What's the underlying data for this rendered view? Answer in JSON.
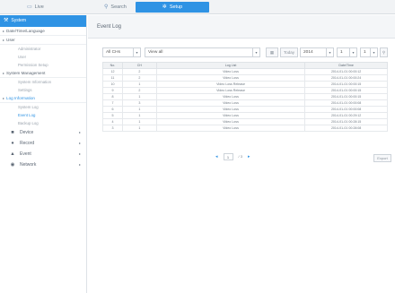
{
  "topbar": {
    "tabs": [
      {
        "label": "Live",
        "icon": "monitor-icon"
      },
      {
        "label": "Search",
        "icon": "search-icon"
      },
      {
        "label": "Setup",
        "icon": "gear-icon"
      }
    ]
  },
  "sidebar": {
    "header": "System",
    "sections": [
      {
        "label": "Date/Time/Language"
      },
      {
        "label": "User",
        "children": [
          "Administrator",
          "User",
          "Permission Setup"
        ]
      },
      {
        "label": "System Management",
        "children": [
          "System Information",
          "Settings"
        ]
      },
      {
        "label": "Log Information",
        "children": [
          "System Log",
          "Event Log",
          "Backup Log"
        ]
      }
    ],
    "main_items": [
      {
        "label": "Device",
        "icon": "camera-icon"
      },
      {
        "label": "Record",
        "icon": "record-icon"
      },
      {
        "label": "Event",
        "icon": "event-icon"
      },
      {
        "label": "Network",
        "icon": "network-icon"
      }
    ]
  },
  "content": {
    "title": "Event Log",
    "filters": {
      "channel": "All CHs",
      "type": "View all",
      "today_label": "Today",
      "year": "2014",
      "month": "1",
      "day": "1"
    },
    "table": {
      "headers": [
        "No.",
        "CH",
        "Log List",
        "Date/Time"
      ],
      "rows": [
        [
          "12",
          "2",
          "Video Loss",
          "2014-01-01 00:00:12"
        ],
        [
          "11",
          "2",
          "Video Loss",
          "2014-01-01 00:00:24"
        ],
        [
          "10",
          "1",
          "Video Loss Release",
          "2014-01-01 00:00:15"
        ],
        [
          "9",
          "2",
          "Video Loss Release",
          "2014-01-01 00:00:15"
        ],
        [
          "8",
          "1",
          "Video Loss",
          "2014-01-01 00:00:15"
        ],
        [
          "7",
          "3",
          "Video Loss",
          "2014-01-01 00:00:08"
        ],
        [
          "6",
          "1",
          "Video Loss",
          "2014-01-01 00:00:08"
        ],
        [
          "5",
          "1",
          "Video Loss",
          "2014-01-01 00:29:12"
        ],
        [
          "4",
          "1",
          "Video Loss",
          "2014-01-01 00:28:15"
        ],
        [
          "3",
          "1",
          "Video Loss",
          "2014-01-01 00:28:08"
        ]
      ]
    },
    "pager": {
      "current": "1",
      "total": "/ 3"
    },
    "export_label": "Export"
  },
  "colors": {
    "accent": "#2f93e4",
    "sidebar_text": "#5a6572"
  }
}
